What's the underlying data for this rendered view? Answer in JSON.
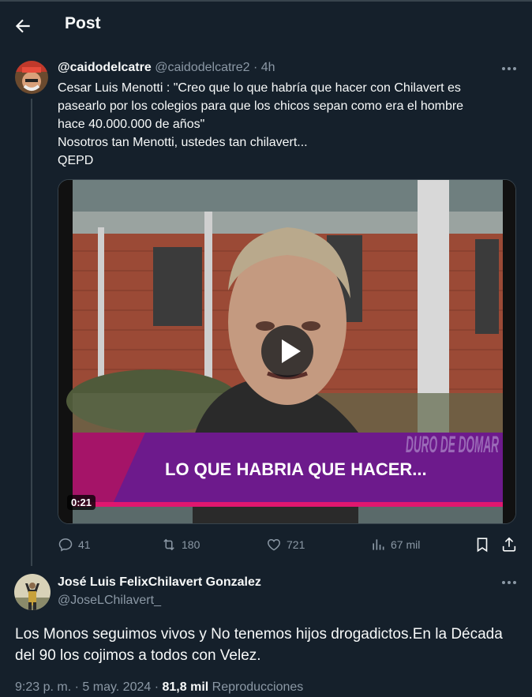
{
  "header": {
    "title": "Post"
  },
  "quoted_post": {
    "display_name": "@caidodelcatre",
    "handle": "@caidodelcatre2",
    "separator": "·",
    "time": "4h",
    "lines": [
      "Cesar Luis Menotti : \"Creo que lo que habría que hacer con Chilavert es",
      "pasearlo por los colegios para que los chicos sepan como era el hombre",
      "hace 40.000.000 de años\"",
      "Nosotros tan Menotti,  ustedes tan chilavert...",
      "QEPD"
    ],
    "video": {
      "caption": "LO QUE HABRIA QUE HACER...",
      "logo": "DURO DE DOMAR",
      "duration": "0:21"
    },
    "actions": {
      "replies": "41",
      "reposts": "180",
      "likes": "721",
      "views": "67 mil"
    }
  },
  "main_post": {
    "display_name": "José Luis FelixChilavert Gonzalez",
    "handle": "@JoseLChilavert_",
    "lines": [
      "Los Monos seguimos vivos y No tenemos hijos drogadictos.En la Década",
      "del 90 los cojimos a todos con Velez."
    ],
    "time": "9:23 p. m.",
    "date": "5 may. 2024",
    "sep": "·",
    "views_count": "81,8 mil",
    "views_label": "Reproducciones"
  },
  "colors": {
    "background": "#15202b",
    "text": "#f7f9f9",
    "muted": "#8b98a5",
    "border": "#38444d"
  }
}
